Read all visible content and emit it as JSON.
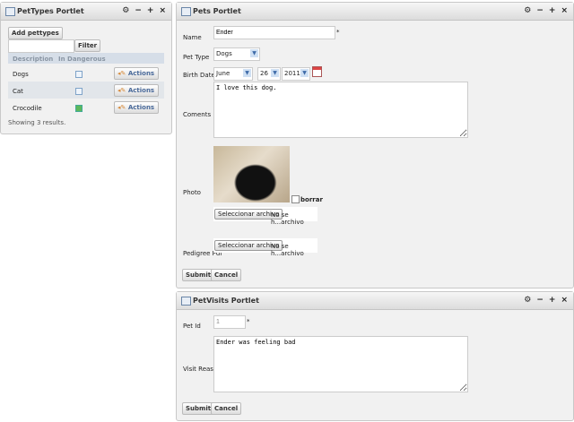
{
  "pettypes": {
    "title": "PetTypes Portlet",
    "add_button": "Add pettypes",
    "filter_value": "",
    "filter_button": "Filter",
    "columns": [
      "Description",
      "In Dangerous"
    ],
    "rows": [
      {
        "description": "Dogs",
        "dangerous": false,
        "action": "Actions"
      },
      {
        "description": "Cat",
        "dangerous": false,
        "action": "Actions"
      },
      {
        "description": "Crocodile",
        "dangerous": true,
        "action": "Actions"
      }
    ],
    "footer": "Showing 3 results."
  },
  "pets": {
    "title": "Pets Portlet",
    "name_label": "Name",
    "name_value": "Ender",
    "required": "*",
    "pettype_label": "Pet Type",
    "pettype_value": "Dogs",
    "birth_label": "Birth Date",
    "month": "June",
    "day": "26",
    "year": "2011",
    "comments_label": "Coments",
    "comments_value": "I love this dog.",
    "photo_label": "Photo",
    "borrar": "borrar",
    "file_button": "Seleccionar archivo",
    "file_text": "No se h...archivo",
    "pedigree_label": "Pedigree Pdf",
    "submit": "Submit",
    "cancel": "Cancel"
  },
  "visits": {
    "title": "PetVisits Portlet",
    "petid_label": "Pet Id",
    "petid_value": "1",
    "required": "*",
    "reason_label": "Visit Reason",
    "reason_value": "Ender was feeling bad",
    "submit": "Submit",
    "cancel": "Cancel"
  },
  "controls": {
    "config": "⚙",
    "minimize": "−",
    "maximize": "+",
    "close": "×"
  }
}
